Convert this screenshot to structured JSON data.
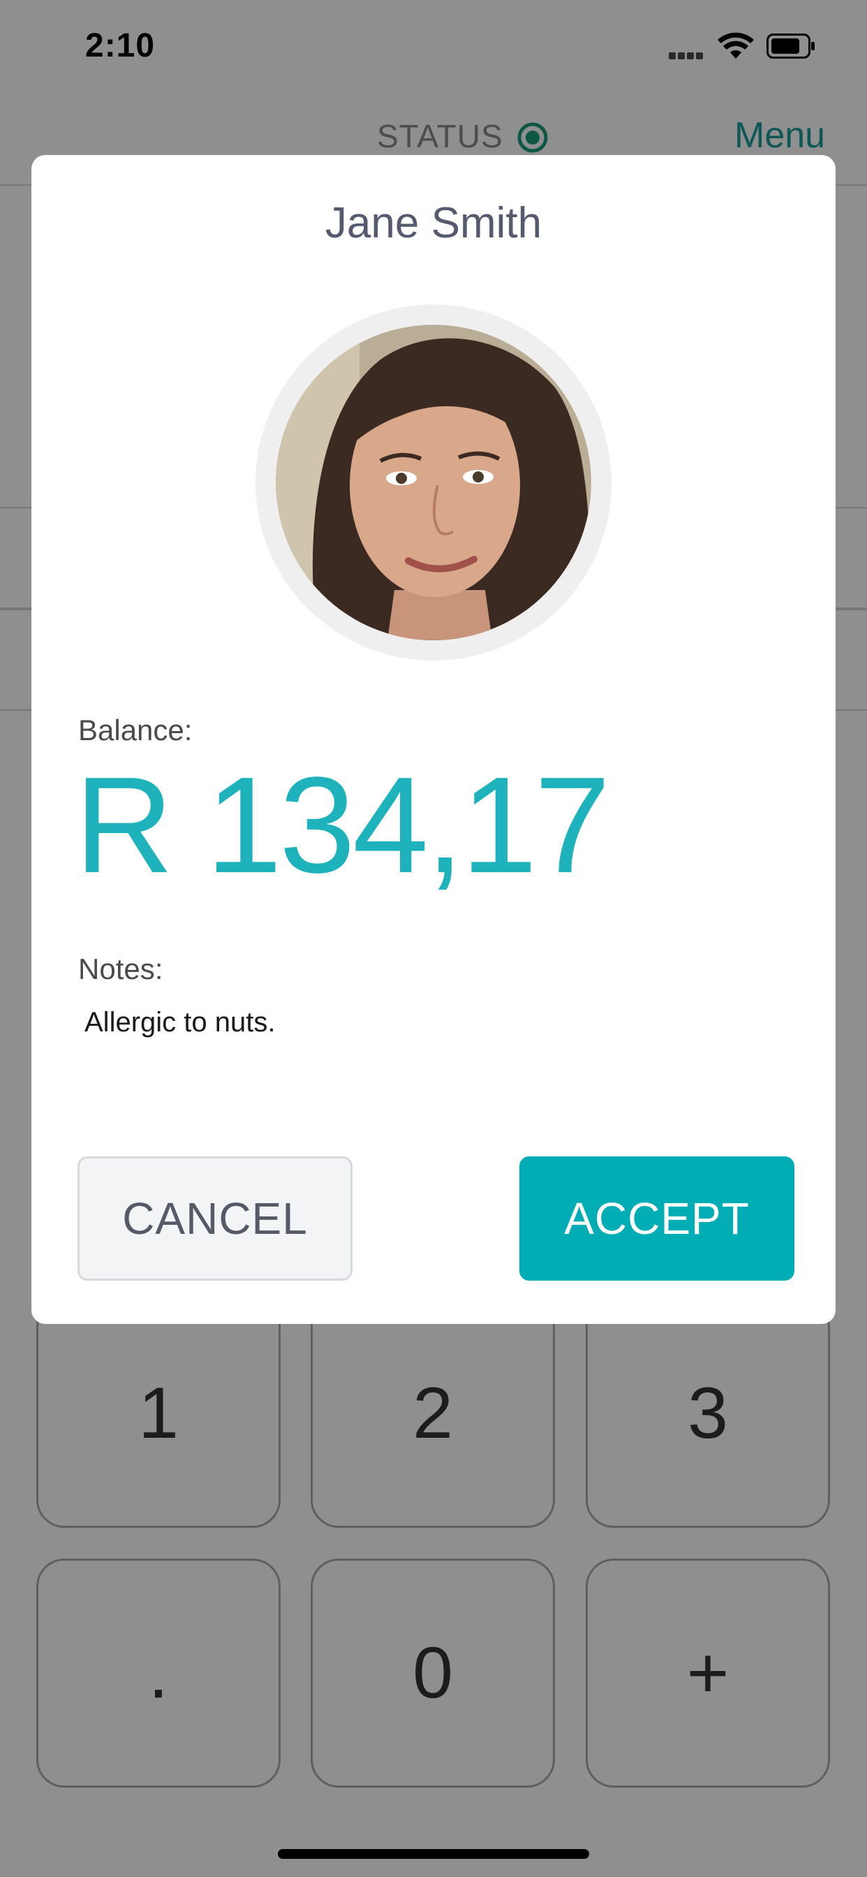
{
  "status_bar": {
    "time": "2:10"
  },
  "nav": {
    "status_label": "STATUS",
    "menu_label": "Menu"
  },
  "keypad": {
    "keys": [
      "1",
      "2",
      "3",
      ".",
      "0",
      "+"
    ]
  },
  "modal": {
    "customer_name": "Jane Smith",
    "balance_label": "Balance:",
    "balance_value": "R 134,17",
    "notes_label": "Notes:",
    "notes_text": "Allergic to nuts.",
    "cancel_label": "CANCEL",
    "accept_label": "ACCEPT"
  },
  "colors": {
    "accent": "#00adb5",
    "balance_text": "#1eb2bd",
    "status_ok": "#1a9c7c",
    "menu_link": "#1a9c9c"
  }
}
